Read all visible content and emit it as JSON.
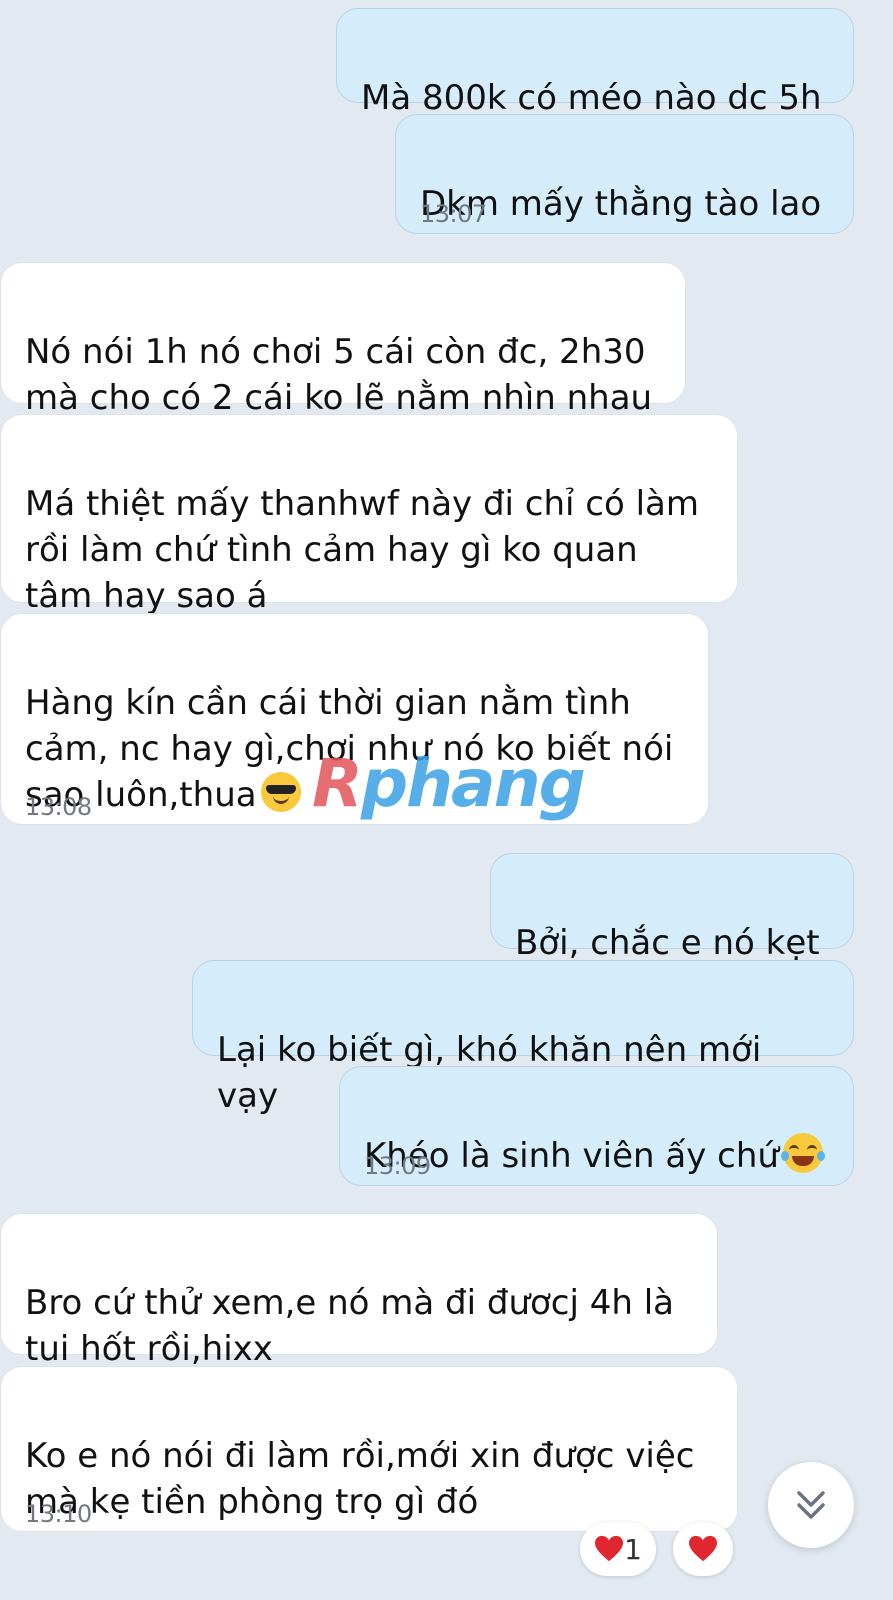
{
  "messages": [
    {
      "dir": "out",
      "text": "Mà 800k có méo nào dc 5h",
      "time": ""
    },
    {
      "dir": "out",
      "text": "Dkm mấy thằng tào lao",
      "time": "13:07"
    },
    {
      "dir": "in",
      "text": "Nó nói 1h nó chơi 5 cái còn đc, 2h30\nmà cho có 2 cái ko lẽ nằm nhìn nhau",
      "time": ""
    },
    {
      "dir": "in",
      "text": "Má thiệt mấy thanhwf này đi chỉ có làm\nrồi làm chứ tình cảm hay gì ko quan\ntâm hay sao á",
      "time": ""
    },
    {
      "dir": "in",
      "text": "Hàng kín cần cái thời gian nằm tình\ncảm, nc hay gì,chơi như nó ko biết nói\nsao luôn,thua",
      "emoji": "sunglasses-emoji",
      "time": "13:08"
    },
    {
      "dir": "out",
      "text": "Bởi, chắc e nó kẹt",
      "time": ""
    },
    {
      "dir": "out",
      "text": "Lại ko biết gì, khó khăn nên mới vạy",
      "time": ""
    },
    {
      "dir": "out",
      "text": "Khéo là sinh viên ấy chứ",
      "emoji": "tears-of-joy-emoji",
      "time": "13:09"
    },
    {
      "dir": "in",
      "text": "Bro cứ thử xem,e nó mà đi đươcj 4h là\ntui hốt rồi,hixx",
      "time": ""
    },
    {
      "dir": "in",
      "text": "Ko e nó nói đi làm rồi,mới xin được việc\nmà kẹ tiền phòng trọ gì đó",
      "time": "13:10"
    }
  ],
  "watermark": {
    "first": "R",
    "rest": "phang"
  },
  "reactions": {
    "count": "1",
    "icon": "red-heart-icon",
    "add_icon": "red-heart-icon"
  },
  "scroll_button": {
    "icon": "double-chevron-down-icon"
  },
  "colors": {
    "background": "#e2e9f1",
    "outgoing": "#d5ecfb",
    "incoming": "#ffffff",
    "heart": "#e0262f"
  }
}
